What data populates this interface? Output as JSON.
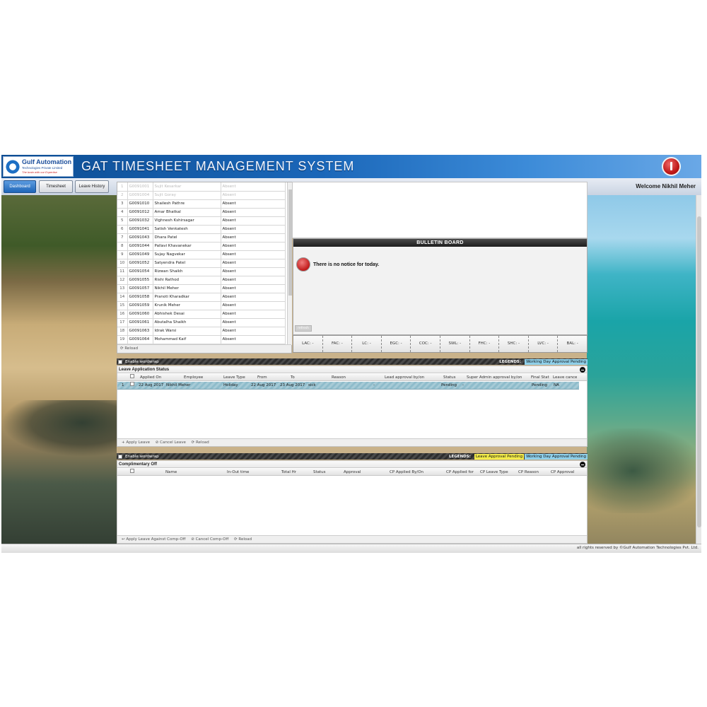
{
  "header": {
    "logo_name": "Gulf Automation",
    "logo_sub": "Technologies Private Limited",
    "logo_tag": "The brain with our Expertise",
    "title": "GAT TIMESHEET MANAGEMENT SYSTEM"
  },
  "nav": {
    "tabs": [
      {
        "label": "Dashboard"
      },
      {
        "label": "Timesheet"
      },
      {
        "label": "Leave History"
      }
    ],
    "welcome": "Welcome  Nikhil Meher"
  },
  "attendance": {
    "rows": [
      {
        "n": "1",
        "code": "G0091001",
        "name": "Sujit Kesarkar",
        "status": "Absent"
      },
      {
        "n": "2",
        "code": "G0091004",
        "name": "Sujit Goray",
        "status": "Absent"
      },
      {
        "n": "3",
        "code": "G0091010",
        "name": "Shailesh Pathre",
        "status": "Absent"
      },
      {
        "n": "4",
        "code": "G0091012",
        "name": "Amar Bhatkal",
        "status": "Absent"
      },
      {
        "n": "5",
        "code": "G0091032",
        "name": "Vighnesh Kshirsagar",
        "status": "Absent"
      },
      {
        "n": "6",
        "code": "G0091041",
        "name": "Satish Venkatesh",
        "status": "Absent"
      },
      {
        "n": "7",
        "code": "G0091043",
        "name": "Dhara Patel",
        "status": "Absent"
      },
      {
        "n": "8",
        "code": "G0091044",
        "name": "Pallavi Khavanekar",
        "status": "Absent"
      },
      {
        "n": "9",
        "code": "G0091049",
        "name": "Sujay Nagvekar",
        "status": "Absent"
      },
      {
        "n": "10",
        "code": "G0091052",
        "name": "Satyendra Patel",
        "status": "Absent"
      },
      {
        "n": "11",
        "code": "G0091054",
        "name": "Rizwan Shaikh",
        "status": "Absent"
      },
      {
        "n": "12",
        "code": "G0091055",
        "name": "Rishi Rathod",
        "status": "Absent"
      },
      {
        "n": "13",
        "code": "G0091057",
        "name": "Nikhil Meher",
        "status": "Absent"
      },
      {
        "n": "14",
        "code": "G0091058",
        "name": "Pranoti Kharadkar",
        "status": "Absent"
      },
      {
        "n": "15",
        "code": "G0091059",
        "name": "Krunik Meher",
        "status": "Absent"
      },
      {
        "n": "16",
        "code": "G0091060",
        "name": "Abhishek Desai",
        "status": "Absent"
      },
      {
        "n": "17",
        "code": "G0091061",
        "name": "Abutalha Shaikh",
        "status": "Absent"
      },
      {
        "n": "18",
        "code": "G0091063",
        "name": "Idrak Warsi",
        "status": "Absent"
      },
      {
        "n": "19",
        "code": "G0091064",
        "name": "Mohammad Kaif",
        "status": "Absent"
      }
    ],
    "reload": "⟳ Reload"
  },
  "bulletin": {
    "title": "BULLETIN BOARD",
    "message": "There is no notice for today.",
    "refresh": "refresh"
  },
  "balances": [
    "LAC: -",
    "FAC: -",
    "LC: -",
    "EGC: -",
    "COC: -",
    "SWL: -",
    "FHC: -",
    "SHC: -",
    "LVC: -",
    "BAL: -"
  ],
  "leave_bar": {
    "wrap_label": "Enable wordwrap",
    "legend_label": "LEGENDS:",
    "legend_items": [
      {
        "label": "Working Day Approval Pending",
        "color": "#8fd0ea"
      }
    ]
  },
  "leave_status": {
    "title": "Leave Application Status",
    "columns": [
      "Applied On",
      "Employee",
      "Leave Type",
      "From",
      "To",
      "Reason",
      "Lead approval by/on",
      "Status",
      "Super Admin approval by/on",
      "Final Stat",
      "Leave cance"
    ],
    "rows": [
      {
        "n": "1",
        "applied_on": "22 Aug 2017",
        "employee": "Nikhil Meher",
        "leave_type": "Holiday",
        "from": "22 Aug 2017",
        "to": "23 Aug 2017",
        "reason": "sick",
        "lead": "-",
        "status": "Pending",
        "super": "-",
        "final": "Pending",
        "cancel": "NA"
      }
    ],
    "footer": {
      "apply": "+ Apply Leave",
      "cancel": "⊘ Cancel Leave",
      "reload": "⟳ Reload"
    }
  },
  "comp_bar": {
    "wrap_label": "Enable wordwrap",
    "legend_label": "LEGENDS:",
    "legend_items": [
      {
        "label": "Leave Approval Pending",
        "color": "#f4ec4a"
      },
      {
        "label": "Working Day Approval Pending",
        "color": "#8fd0ea"
      }
    ]
  },
  "comp_off": {
    "title": "Complimentary Off",
    "columns": [
      "Name",
      "In-Out time",
      "Total Hr",
      "Status",
      "Approval",
      "CP Applied By/On",
      "CP Applied for",
      "CP Leave Type",
      "CP Reason",
      "CP Approval"
    ],
    "footer": {
      "apply": "↩ Apply Leave Against Comp-Off",
      "cancel": "⊘ Cancel Comp-Off",
      "reload": "⟳ Reload"
    }
  },
  "footer": {
    "copyright": "all rights reserved by ©Gulf Automation Technologies Pvt. Ltd."
  }
}
